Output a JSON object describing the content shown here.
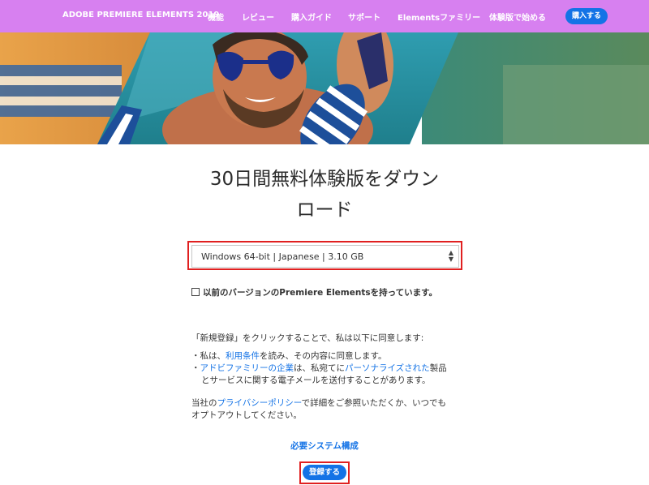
{
  "nav": {
    "brand": "ADOBE PREMIERE ELEMENTS 2019",
    "items": [
      "機能",
      "レビュー",
      "購入ガイド",
      "サポート",
      "Elementsファミリー",
      "体験版で始める"
    ],
    "buy": "購入する"
  },
  "hero": {
    "image": "man-with-heart-sunglasses-and-flip-flop-photo"
  },
  "main": {
    "title_line1": "30日間無料体験版をダウン",
    "title_line2": "ロード",
    "select_value": "Windows 64-bit | Japanese | 3.10 GB",
    "checkbox_label": "以前のバージョンのPremiere Elementsを持っています。",
    "legal": {
      "intro": "「新規登録」をクリックすることで、私は以下に同意します:",
      "b1_pre": "私は、",
      "b1_link": "利用条件",
      "b1_post": "を読み、その内容に同意します。",
      "b2_link1": "アドビファミリーの企業",
      "b2_mid": "は、私宛てに",
      "b2_link2": "パーソナライズされた",
      "b2_post": "製品",
      "b2_line2": "とサービスに関する電子メールを送付することがあります。",
      "privacy_pre": "当社の",
      "privacy_link": "プライバシーポリシー",
      "privacy_post": "で詳細をご参照いただくか、いつでも",
      "privacy_line2": "オプトアウトしてください。"
    },
    "sysreq": "必要システム構成",
    "register": "登録する"
  },
  "colors": {
    "nav_bg": "#d780f0",
    "accent": "#1473e6",
    "highlight": "#e02020"
  }
}
